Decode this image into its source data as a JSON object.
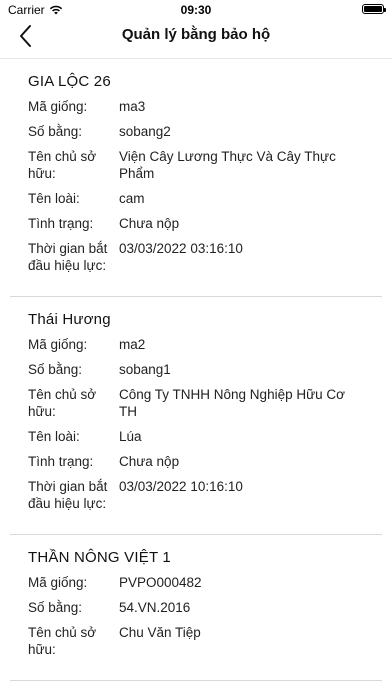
{
  "status": {
    "carrier": "Carrier",
    "time": "09:30",
    "battery_level": 1.0
  },
  "header": {
    "title": "Quản lý bằng bảo hộ"
  },
  "labels": {
    "ma_giong": "Mã giống:",
    "so_bang": "Số bằng:",
    "ten_chu": "Tên chủ sở hữu:",
    "ten_loai": "Tên loài:",
    "tinh_trang": "Tình trạng:",
    "thoi_gian": "Thời gian bắt đầu hiệu lực:"
  },
  "cards": [
    {
      "title": "GIA LỘC 26",
      "ma_giong": "ma3",
      "so_bang": "sobang2",
      "ten_chu": "Viện Cây Lương Thực Và Cây Thực Phẩm",
      "ten_loai": "cam",
      "tinh_trang": "Chưa nộp",
      "thoi_gian": "03/03/2022 03:16:10"
    },
    {
      "title": "Thái Hương",
      "ma_giong": "ma2",
      "so_bang": "sobang1",
      "ten_chu": "Công Ty TNHH Nông Nghiệp Hữu Cơ TH",
      "ten_loai": "Lúa",
      "tinh_trang": "Chưa nộp",
      "thoi_gian": "03/03/2022 10:16:10"
    },
    {
      "title": "THẦN NÔNG VIỆT 1",
      "ma_giong": "PVPO000482",
      "so_bang": "54.VN.2016",
      "ten_chu": "Chu Văn Tiệp"
    }
  ]
}
